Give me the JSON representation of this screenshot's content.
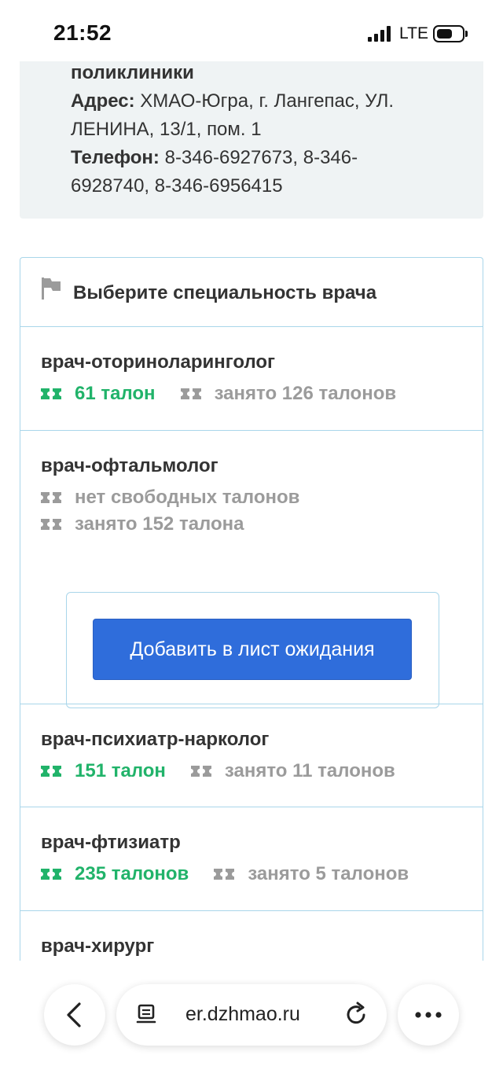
{
  "status_bar": {
    "time": "21:52",
    "network": "LTE"
  },
  "info": {
    "tail": "поликлиники",
    "address_label": "Адрес:",
    "address_line1": "ХМАО-Югра, г. Лангепас, УЛ.",
    "address_line2": "ЛЕНИНА, 13/1, пом. 1",
    "phone_label": "Телефон:",
    "phone_line1": "8-346-6927673, 8-346-",
    "phone_line2": "6928740, 8-346-6956415"
  },
  "card": {
    "title": "Выберите специальность врача"
  },
  "specialties": [
    {
      "name": "врач-оториноларинголог",
      "free": "61 талон",
      "busy": "занято 126 талонов"
    },
    {
      "name": "врач-офтальмолог",
      "free": "нет свободных талонов",
      "busy": "занято 152 талона",
      "waitlist_button": "Добавить в лист ожидания"
    },
    {
      "name": "врач-психиатр-нарколог",
      "free": "151 талон",
      "busy": "занято 11 талонов"
    },
    {
      "name": "врач-фтизиатр",
      "free": "235 талонов",
      "busy": "занято 5 талонов"
    },
    {
      "name": "врач-хирург"
    }
  ],
  "browser": {
    "url": "er.dzhmao.ru"
  },
  "colors": {
    "free": "#21b36a",
    "busy": "#9b9b9b",
    "border": "#a9d6ea",
    "button": "#2f6ddb",
    "panel": "#eff3f4"
  },
  "icons": [
    "flag-icon",
    "ticket-icon",
    "back-arrow-icon",
    "reader-mode-icon",
    "reload-icon",
    "more-icon"
  ]
}
